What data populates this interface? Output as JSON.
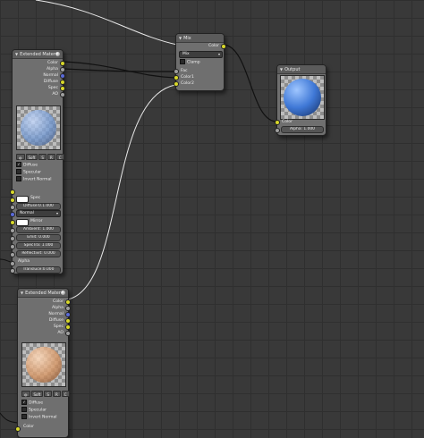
{
  "nodes": {
    "mat1": {
      "title": "Extended Mater",
      "outputs": [
        "Color",
        "Alpha",
        "Normal",
        "Diffuse",
        "Spec",
        "AO"
      ],
      "preview_color": "#7fa6d8",
      "buttons": [
        "Soft",
        "S",
        "R",
        "C"
      ],
      "checks": [
        {
          "label": "Diffuse",
          "checked": true
        },
        {
          "label": "Specular",
          "checked": false
        },
        {
          "label": "Invert Normal",
          "checked": false
        }
      ],
      "spec_label": "Spec",
      "diffuse_intensity": "Diffuse:0.1.000",
      "normal_select": "Normal",
      "mirror_label": "Mirror",
      "fields": [
        "Ambient: 1.000",
        "Emit: 0.000",
        "SpecTra: 1.000",
        "Reflectivit: 0.000"
      ],
      "alpha_label": "Alpha",
      "transluc": "Transluce:0.000"
    },
    "mat2": {
      "title": "Extended Mater",
      "outputs": [
        "Color",
        "Alpha",
        "Normal",
        "Diffuse",
        "Spec",
        "AO"
      ],
      "preview_color": "#d99a66",
      "buttons": [
        "Soft",
        "S",
        "R",
        "C"
      ],
      "checks": [
        {
          "label": "Diffuse",
          "checked": true
        },
        {
          "label": "Specular",
          "checked": false
        },
        {
          "label": "Invert Normal",
          "checked": false
        }
      ],
      "bottom_label": "Color"
    },
    "mix": {
      "title": "Mix",
      "output": "Color",
      "blend_mode": "Mix",
      "clamp_label": "Clamp",
      "inputs": [
        "Fac",
        "Color1",
        "Color2"
      ]
    },
    "output": {
      "title": "Output",
      "preview_color": "#3f78d6",
      "inputs": [
        "Color"
      ],
      "alpha_field": "Alpha: 1.000"
    }
  },
  "colors": {
    "background": "#393939",
    "node_body": "#6f6f6f",
    "socket_color": "#d8d82a",
    "socket_vector": "#5a6ad8",
    "wire": "#e8e8e8"
  }
}
